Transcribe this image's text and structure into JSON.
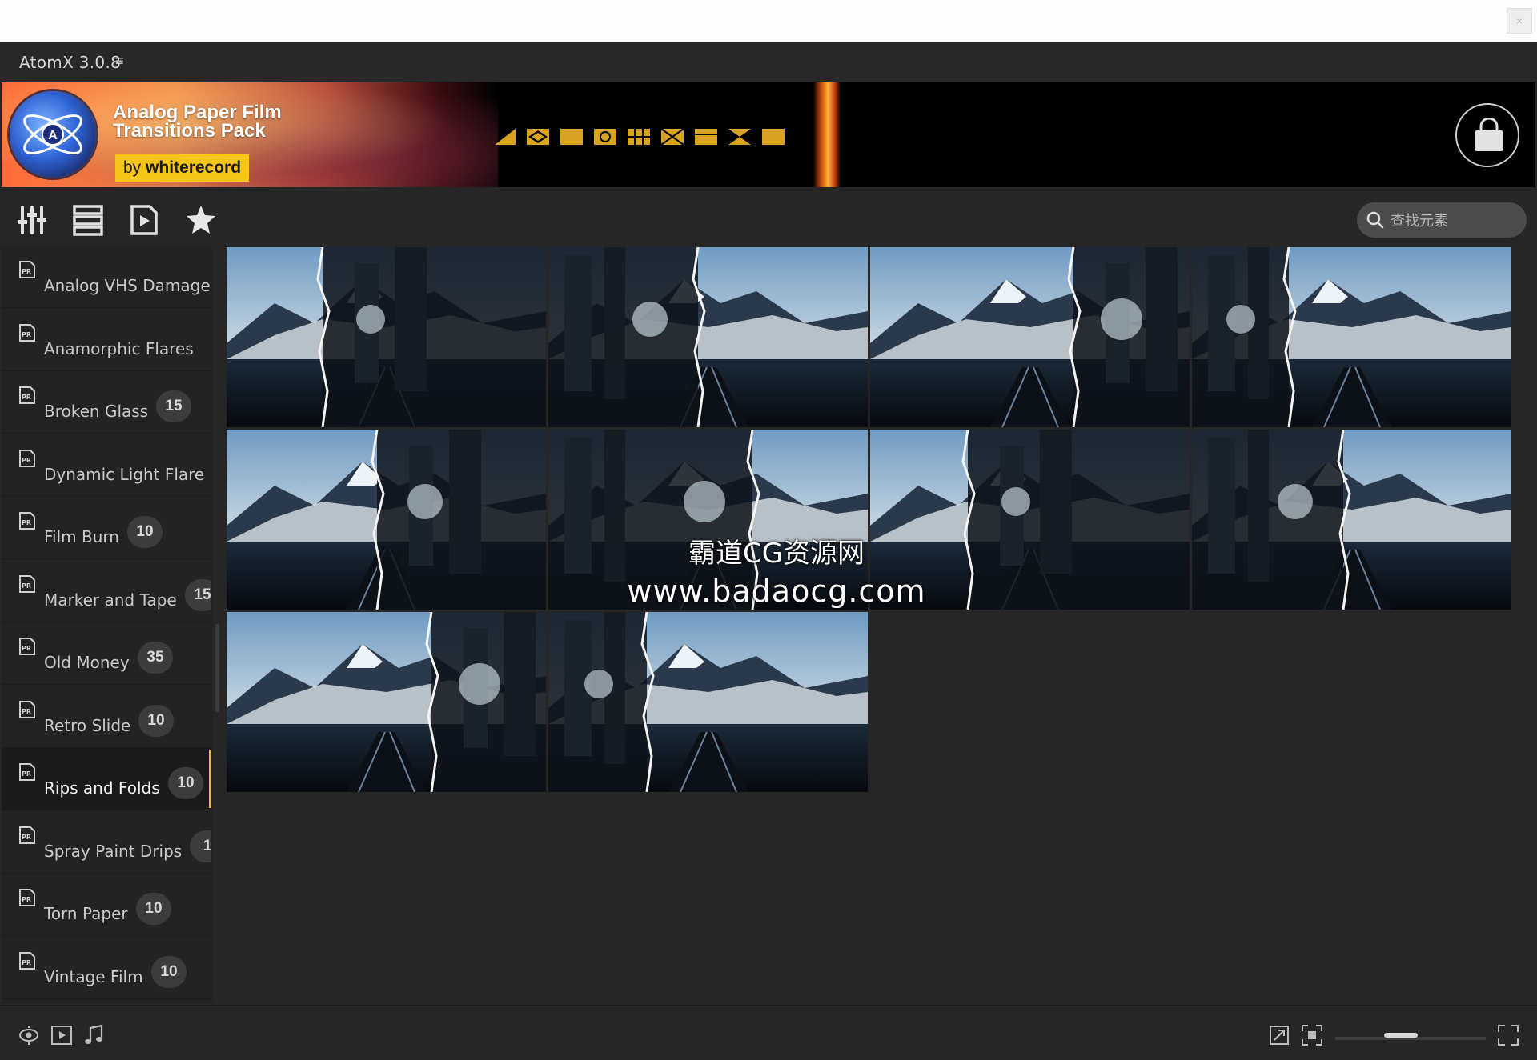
{
  "app": {
    "title": "AtomX 3.0.8"
  },
  "banner": {
    "title": "Analog Paper Film Transitions Pack",
    "by_prefix": "by",
    "by_author": "whiterecord",
    "accent_color": "#f5c518"
  },
  "search": {
    "placeholder": "查找元素",
    "value": ""
  },
  "toolbar": {
    "icons": [
      "sliders-icon",
      "list-icon",
      "document-play-icon",
      "star-icon"
    ]
  },
  "sidebar": {
    "items": [
      {
        "label": "Analog VHS Damage",
        "count": "",
        "active": false
      },
      {
        "label": "Anamorphic Flares",
        "count": "",
        "active": false
      },
      {
        "label": "Broken Glass",
        "count": "15",
        "active": false
      },
      {
        "label": "Dynamic Light Flare",
        "count": "",
        "active": false
      },
      {
        "label": "Film Burn",
        "count": "10",
        "active": false
      },
      {
        "label": "Marker and Tape",
        "count": "15",
        "active": false
      },
      {
        "label": "Old Money",
        "count": "35",
        "active": false
      },
      {
        "label": "Retro Slide",
        "count": "10",
        "active": false
      },
      {
        "label": "Rips and Folds",
        "count": "10",
        "active": true
      },
      {
        "label": "Spray Paint Drips",
        "count": "1",
        "active": false
      },
      {
        "label": "Torn Paper",
        "count": "10",
        "active": false
      },
      {
        "label": "Vintage Film",
        "count": "10",
        "active": false
      }
    ]
  },
  "grid": {
    "thumbnail_count": 10,
    "category": "Rips and Folds"
  },
  "watermark": {
    "line1": "霸道CG资源网",
    "line2": "www.badaocg.com"
  },
  "footer": {
    "left_icons": [
      "preview-eye-icon",
      "video-icon",
      "music-icon"
    ],
    "right_icons": [
      "expand-icon",
      "fit-screen-icon",
      "fullscreen-icon"
    ],
    "zoom_level": 0.42
  }
}
